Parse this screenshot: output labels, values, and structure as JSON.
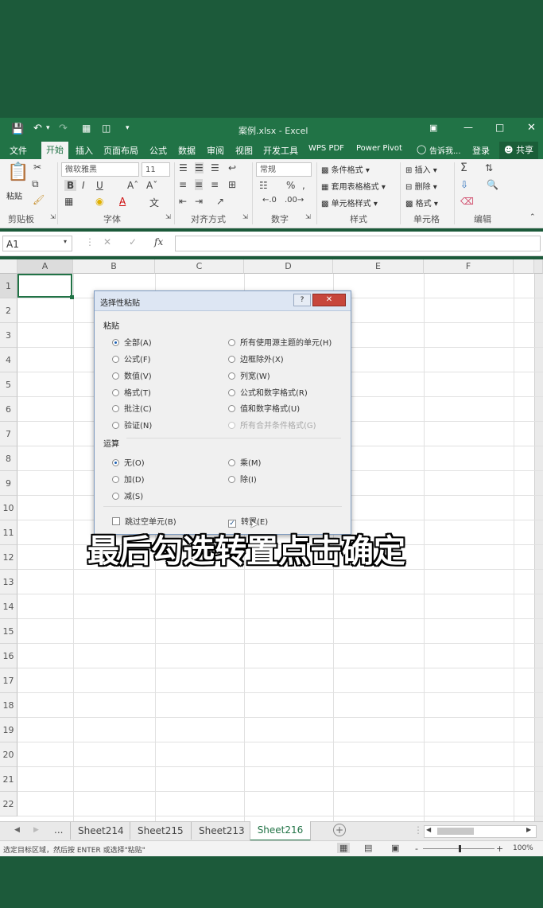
{
  "window": {
    "title": "案例.xlsx - Excel",
    "qat_icons": [
      "save-icon",
      "undo-icon",
      "redo-icon",
      "form-icon",
      "preview-icon",
      "customize-icon"
    ]
  },
  "menu": {
    "tabs": [
      "文件",
      "开始",
      "插入",
      "页面布局",
      "公式",
      "数据",
      "审阅",
      "视图",
      "开发工具",
      "WPS PDF",
      "Power Pivot"
    ],
    "active_tab": "开始",
    "tell_me": "告诉我...",
    "login": "登录",
    "share": "共享"
  },
  "ribbon": {
    "clipboard": {
      "paste": "粘贴",
      "label": "剪贴板"
    },
    "font": {
      "name": "微软雅黑",
      "size": "11",
      "label": "字体",
      "bold": "B",
      "italic": "I",
      "underline": "U"
    },
    "alignment": {
      "label": "对齐方式"
    },
    "number": {
      "format": "常规",
      "label": "数字"
    },
    "styles": {
      "conditional": "条件格式",
      "table": "套用表格格式",
      "cell": "单元格样式",
      "label": "样式"
    },
    "cells": {
      "insert": "插入",
      "delete": "删除",
      "format": "格式",
      "label": "单元格"
    },
    "editing": {
      "label": "编辑"
    }
  },
  "formula_bar": {
    "name_box": "A1",
    "fx": "fx",
    "value": ""
  },
  "grid": {
    "columns": [
      "A",
      "B",
      "C",
      "D",
      "E",
      "F"
    ],
    "rows": [
      "1",
      "2",
      "3",
      "4",
      "5",
      "6",
      "7",
      "8",
      "9",
      "10",
      "11",
      "12",
      "13",
      "14",
      "15",
      "16",
      "17",
      "18",
      "19",
      "20",
      "21",
      "22"
    ],
    "selected_cell": "A1"
  },
  "dialog": {
    "title": "选择性粘贴",
    "help": "?",
    "paste_label": "粘贴",
    "paste_left": [
      "全部(A)",
      "公式(F)",
      "数值(V)",
      "格式(T)",
      "批注(C)",
      "验证(N)"
    ],
    "paste_right": [
      "所有使用源主题的单元(H)",
      "边框除外(X)",
      "列宽(W)",
      "公式和数字格式(R)",
      "值和数字格式(U)",
      "所有合并条件格式(G)"
    ],
    "paste_selected": "全部(A)",
    "operation_label": "运算",
    "op_left": [
      "无(O)",
      "加(D)",
      "减(S)"
    ],
    "op_right": [
      "乘(M)",
      "除(I)"
    ],
    "op_selected": "无(O)",
    "skip_blanks": "跳过空单元(B)",
    "skip_blanks_checked": false,
    "transpose": "转置(E)",
    "transpose_checked": true
  },
  "sheets": {
    "tabs": [
      "Sheet214",
      "Sheet215",
      "Sheet213",
      "Sheet216"
    ],
    "active": "Sheet216",
    "more": "..."
  },
  "status": {
    "message": "选定目标区域，然后按 ENTER 或选择\"粘贴\"",
    "zoom": "100%",
    "zoom_minus": "-",
    "zoom_plus": "+"
  },
  "caption": "最后勾选转置点击确定",
  "colors": {
    "excel_green": "#217346",
    "background": "#1c5a3a"
  }
}
